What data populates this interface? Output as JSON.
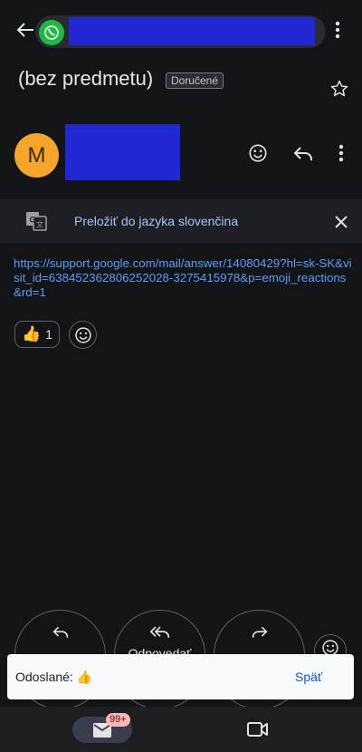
{
  "header": {
    "app_icon": "whatsapp-icon"
  },
  "subject": {
    "title": "(bez predmetu)",
    "label": "Doručené"
  },
  "sender": {
    "avatar_letter": "M"
  },
  "translate": {
    "text": "Preložiť do jazyka slovenčina"
  },
  "message": {
    "link": "https://support.google.com/mail/answer/14080429?hl=sk-SK&visit_id=638452362806252028-3275415978&p=emoji_reactions&rd=1",
    "reaction_emoji": "👍",
    "reaction_count": "1"
  },
  "actions": {
    "reply_all_label": "Odpovedať"
  },
  "snackbar": {
    "text": "Odoslané: 👍",
    "action": "Späť"
  },
  "bottom_nav": {
    "mail_badge": "99+"
  },
  "colors": {
    "background": "#131418",
    "link": "#5e9df7",
    "avatar": "#f6a52a",
    "whatsapp": "#1fba3f",
    "redaction": "#2128d3",
    "snackbar_action": "#0b57d0"
  }
}
